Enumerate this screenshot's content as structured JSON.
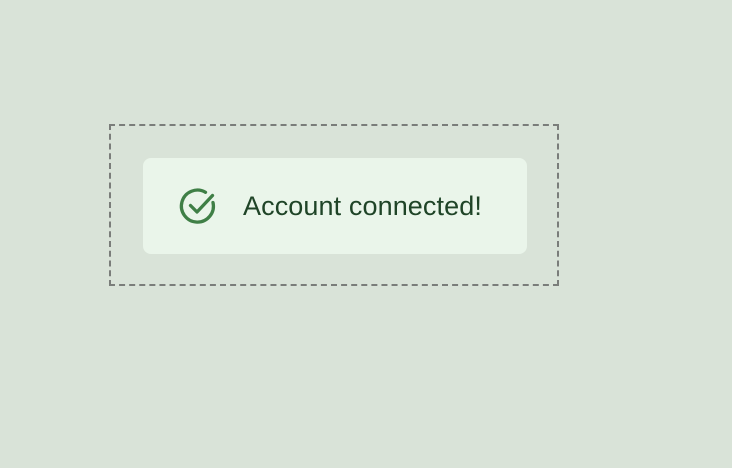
{
  "toast": {
    "message": "Account connected!",
    "icon": "check-circle-icon",
    "status": "success"
  },
  "colors": {
    "page_background": "#d9e3d8",
    "toast_background": "#eaf5ea",
    "icon": "#3f7f46",
    "text": "#1f4427",
    "selection_border": "#7a7d7a"
  }
}
